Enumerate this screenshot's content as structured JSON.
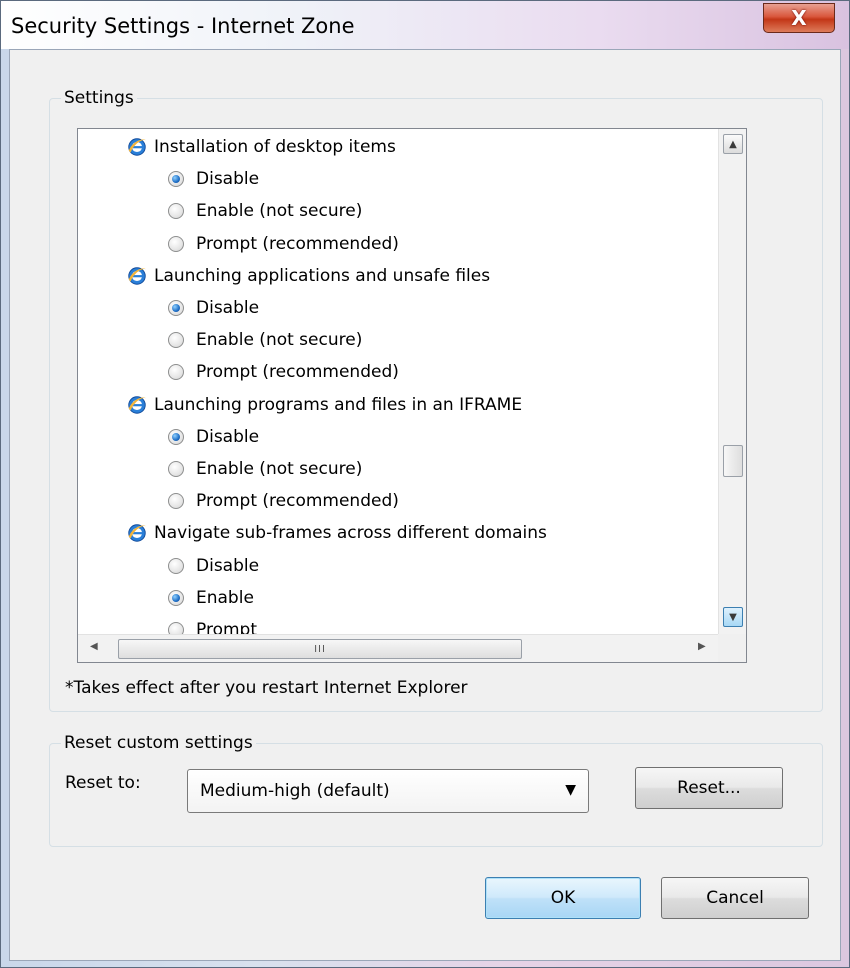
{
  "window": {
    "title": "Security Settings - Internet Zone",
    "close_label": "X"
  },
  "settings_group": {
    "label": "Settings",
    "items": [
      {
        "type": "header",
        "label": "Installation of desktop items"
      },
      {
        "type": "option",
        "label": "Disable",
        "checked": true
      },
      {
        "type": "option",
        "label": "Enable (not secure)",
        "checked": false
      },
      {
        "type": "option",
        "label": "Prompt (recommended)",
        "checked": false
      },
      {
        "type": "header",
        "label": "Launching applications and unsafe files"
      },
      {
        "type": "option",
        "label": "Disable",
        "checked": true
      },
      {
        "type": "option",
        "label": "Enable (not secure)",
        "checked": false
      },
      {
        "type": "option",
        "label": "Prompt (recommended)",
        "checked": false
      },
      {
        "type": "header",
        "label": "Launching programs and files in an IFRAME"
      },
      {
        "type": "option",
        "label": "Disable",
        "checked": true
      },
      {
        "type": "option",
        "label": "Enable (not secure)",
        "checked": false
      },
      {
        "type": "option",
        "label": "Prompt (recommended)",
        "checked": false
      },
      {
        "type": "header",
        "label": "Navigate sub-frames across different domains"
      },
      {
        "type": "option",
        "label": "Disable",
        "checked": false
      },
      {
        "type": "option",
        "label": "Enable",
        "checked": true
      },
      {
        "type": "option",
        "label": "Prompt",
        "checked": false
      }
    ],
    "note": "*Takes effect after you restart Internet Explorer",
    "hscroll_grip": "III"
  },
  "reset_group": {
    "label": "Reset custom settings",
    "reset_to_label": "Reset to:",
    "selected_level": "Medium-high (default)",
    "reset_button": "Reset..."
  },
  "footer": {
    "ok_label": "OK",
    "cancel_label": "Cancel"
  },
  "icons": {
    "settings_item": "internet-explorer-icon"
  },
  "colors": {
    "close_button": "#c33617",
    "radio_selected": "#1f6fc6",
    "default_button_border": "#3c7fb1"
  }
}
